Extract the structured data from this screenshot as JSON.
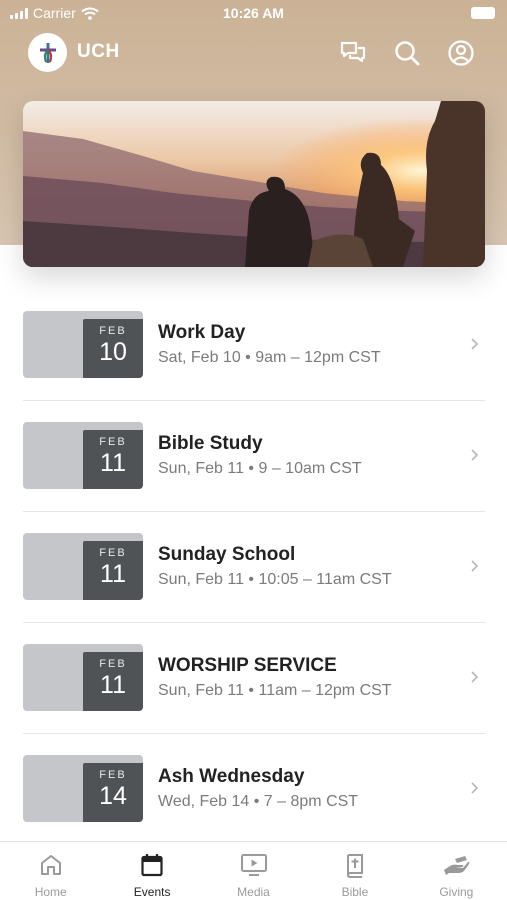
{
  "status_bar": {
    "carrier": "Carrier",
    "time": "10:26 AM"
  },
  "header": {
    "title": "UCH"
  },
  "events": [
    {
      "month": "FEB",
      "day": "10",
      "title": "Work Day",
      "subtitle": "Sat, Feb 10 • 9am – 12pm CST"
    },
    {
      "month": "FEB",
      "day": "11",
      "title": "Bible Study",
      "subtitle": "Sun, Feb 11 • 9 – 10am CST"
    },
    {
      "month": "FEB",
      "day": "11",
      "title": "Sunday School",
      "subtitle": "Sun, Feb 11 • 10:05 – 11am CST"
    },
    {
      "month": "FEB",
      "day": "11",
      "title": "WORSHIP SERVICE",
      "subtitle": "Sun, Feb 11 • 11am – 12pm CST"
    },
    {
      "month": "FEB",
      "day": "14",
      "title": "Ash Wednesday",
      "subtitle": "Wed, Feb 14 • 7 – 8pm CST"
    }
  ],
  "tabs": [
    {
      "label": "Home",
      "icon": "home-icon"
    },
    {
      "label": "Events",
      "icon": "calendar-icon",
      "active": true
    },
    {
      "label": "Media",
      "icon": "media-icon"
    },
    {
      "label": "Bible",
      "icon": "bible-icon"
    },
    {
      "label": "Giving",
      "icon": "giving-icon"
    }
  ],
  "colors": {
    "header_bg": "#cbb296",
    "date_badge": "#505356",
    "thumb_bg": "#c4c6ca",
    "active_tab": "#222222",
    "inactive_tab": "#9a9a9a"
  }
}
